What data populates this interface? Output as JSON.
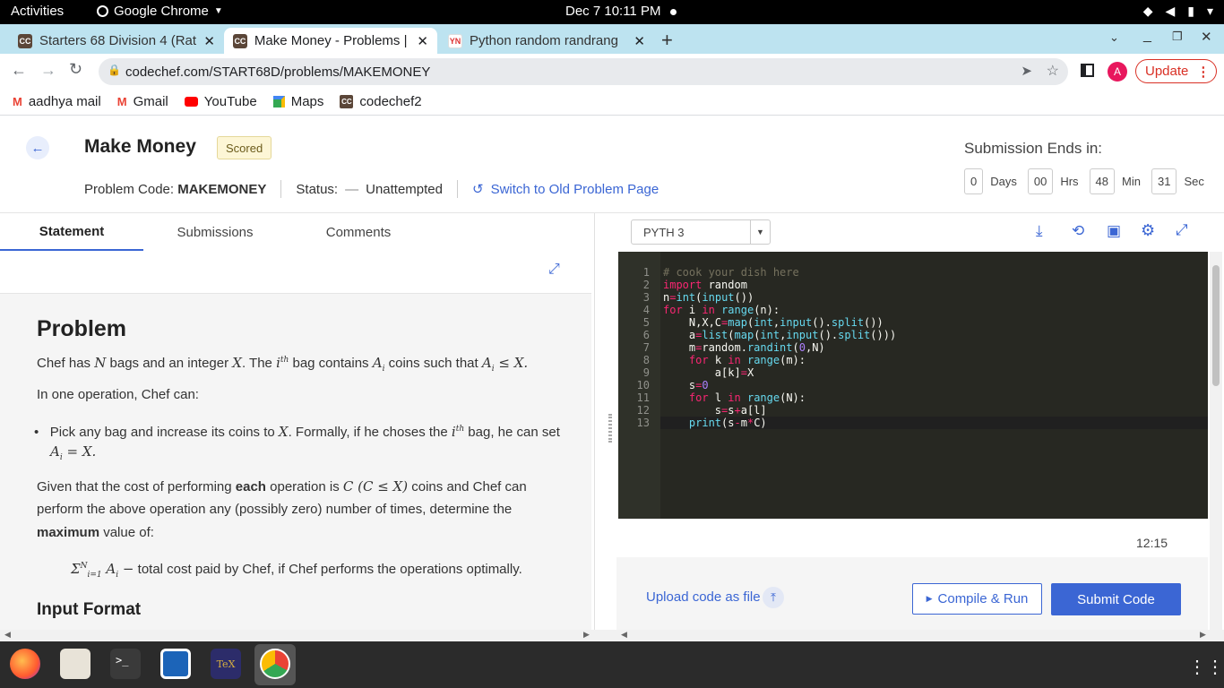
{
  "system": {
    "activities": "Activities",
    "app_name": "Google Chrome",
    "clock": "Dec 7  10:11 PM"
  },
  "tabs": [
    {
      "title": "Starters 68 Division 4 (Rat",
      "favicon": "CC"
    },
    {
      "title": "Make Money - Problems | C",
      "favicon": "CC"
    },
    {
      "title": "Python random randrang",
      "favicon": "YN"
    }
  ],
  "browser": {
    "url": "codechef.com/START68D/problems/MAKEMONEY",
    "profile_initial": "A",
    "update_label": "Update"
  },
  "bookmarks": [
    {
      "label": "aadhya mail",
      "icon": "gmail-icon"
    },
    {
      "label": "Gmail",
      "icon": "gmail-icon"
    },
    {
      "label": "YouTube",
      "icon": "youtube-icon"
    },
    {
      "label": "Maps",
      "icon": "maps-icon"
    },
    {
      "label": "codechef2",
      "icon": "codechef-icon"
    }
  ],
  "problem": {
    "title": "Make Money",
    "badge": "Scored",
    "code_label": "Problem Code:",
    "code": "MAKEMONEY",
    "status_label": "Status:",
    "status": "Unattempted",
    "switch_link": "Switch to Old Problem Page"
  },
  "timer": {
    "title": "Submission Ends in:",
    "days": "0",
    "days_label": "Days",
    "hrs": "00",
    "hrs_label": "Hrs",
    "min": "48",
    "min_label": "Min",
    "sec": "31",
    "sec_label": "Sec"
  },
  "panel_tabs": [
    "Statement",
    "Submissions",
    "Comments"
  ],
  "statement": {
    "heading": "Problem",
    "p1_a": "Chef has ",
    "p1_b": " bags and an integer ",
    "p1_c": ". The ",
    "p1_d": " bag contains ",
    "p1_e": " coins such that ",
    "p2": "In one operation, Chef can:",
    "bullet_a": "Pick any bag and increase its coins to ",
    "bullet_b": ". Formally, if he choses the ",
    "bullet_c": " bag, he can set",
    "p3_a": "Given that the cost of performing ",
    "p3_bold1": "each",
    "p3_b": " operation is ",
    "p3_c": " coins and Chef can",
    "p3_line2": "perform the above operation any (possibly zero) number of times, determine the",
    "p3_bold2": "maximum",
    "p3_d": " value of:",
    "formula_tail": " total cost paid by Chef, if Chef performs the operations optimally.",
    "input_heading": "Input Format"
  },
  "editor": {
    "language": "PYTH 3",
    "lines": [
      "# cook your dish here",
      "import random",
      "n=int(input())",
      "for i in range(n):",
      "    N,X,C=map(int,input().split())",
      "    a=list(map(int,input().split()))",
      "    m=random.randint(0,N)",
      "    for k in range(m):",
      "        a[k]=X",
      "    s=0",
      "    for l in range(N):",
      "        s=s+a[l]",
      "    print(s-m*C)"
    ],
    "line_numbers": [
      "1",
      "2",
      "3",
      "4",
      "5",
      "6",
      "7",
      "8",
      "9",
      "10",
      "11",
      "12",
      "13"
    ],
    "time": "12:15"
  },
  "actions": {
    "upload": "Upload code as file",
    "compile": "Compile & Run",
    "submit": "Submit Code"
  }
}
